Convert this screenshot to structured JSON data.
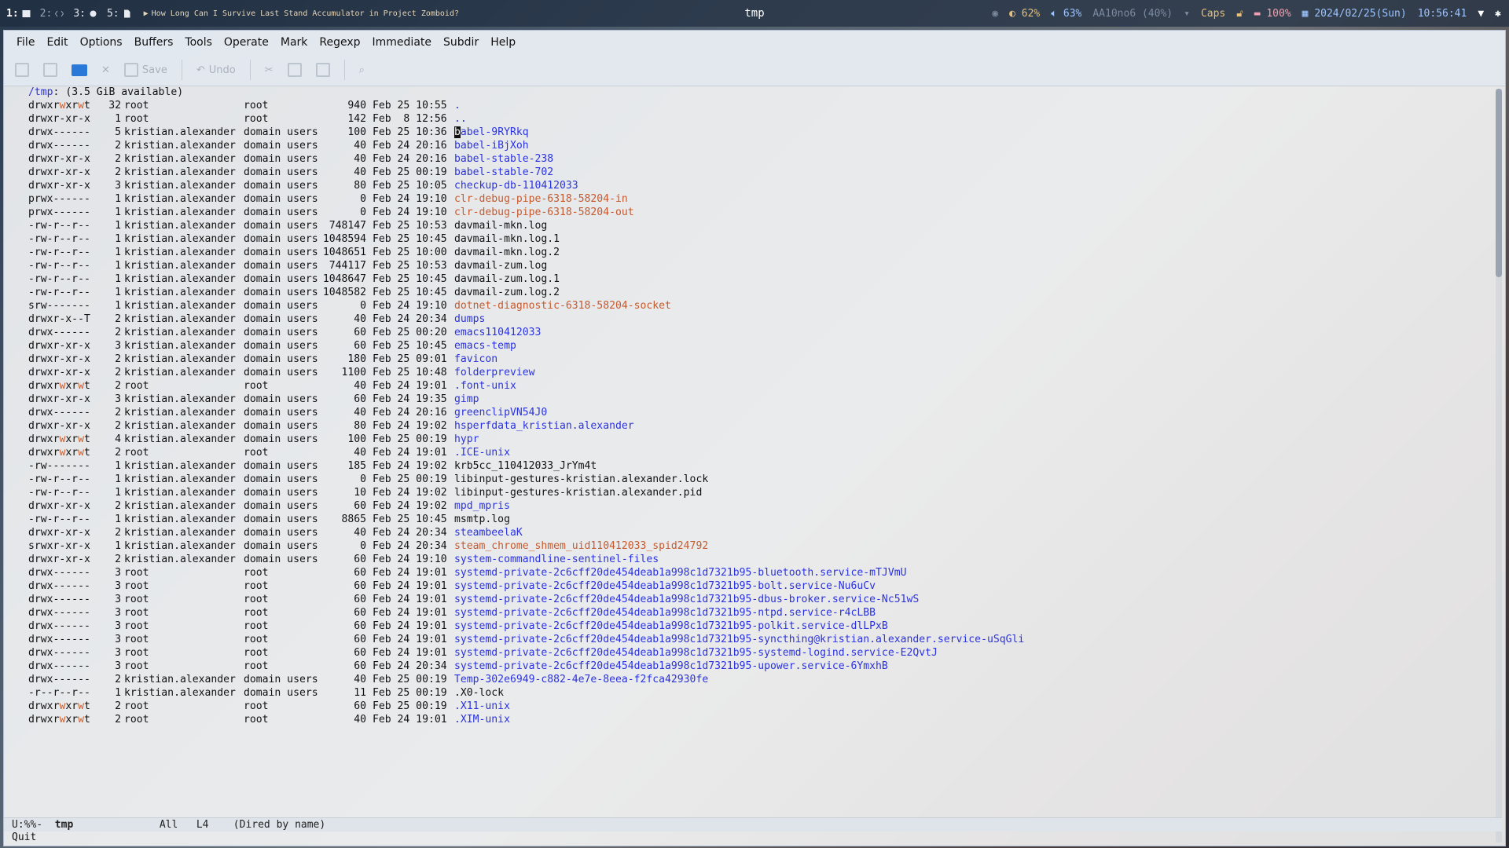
{
  "topbar": {
    "workspaces": [
      {
        "num": "1:",
        "icon": "terminal-icon"
      },
      {
        "num": "2:",
        "icon": "code-icon"
      },
      {
        "num": "3:",
        "icon": "circle-icon"
      },
      {
        "num": "5:",
        "icon": "file-icon"
      }
    ],
    "window_title": "How Long Can I Survive Last Stand Accumulator in Project Zomboid?",
    "center_title": "tmp",
    "brightness": "62%",
    "volume": "63%",
    "keyboard": "AA10no6 (40%)",
    "caps": "Caps",
    "battery": "100%",
    "date": "2024/02/25(Sun)",
    "time": "10:56:41"
  },
  "menu": [
    "File",
    "Edit",
    "Options",
    "Buffers",
    "Tools",
    "Operate",
    "Mark",
    "Regexp",
    "Immediate",
    "Subdir",
    "Help"
  ],
  "toolbar": {
    "save_label": "Save",
    "undo_label": "Undo"
  },
  "dired": {
    "header_path": "/tmp",
    "header_rest": ": (3.5 GiB available)",
    "entries": [
      {
        "perm": "drwxrwxrwt",
        "links": "32",
        "owner": "root",
        "group": "root",
        "size": "940",
        "date": "Feb 25 10:55",
        "name": ".",
        "kind": "dir"
      },
      {
        "perm": "drwxr-xr-x",
        "links": "1",
        "owner": "root",
        "group": "root",
        "size": "142",
        "date": "Feb  8 12:56",
        "name": "..",
        "kind": "dir"
      },
      {
        "perm": "drwx------",
        "links": "5",
        "owner": "kristian.alexander",
        "group": "domain users",
        "size": "100",
        "date": "Feb 25 10:36",
        "name": "babel-9RYRkq",
        "kind": "dir"
      },
      {
        "perm": "drwx------",
        "links": "2",
        "owner": "kristian.alexander",
        "group": "domain users",
        "size": "40",
        "date": "Feb 24 20:16",
        "name": "babel-iBjXoh",
        "kind": "dir"
      },
      {
        "perm": "drwxr-xr-x",
        "links": "2",
        "owner": "kristian.alexander",
        "group": "domain users",
        "size": "40",
        "date": "Feb 24 20:16",
        "name": "babel-stable-238",
        "kind": "dir"
      },
      {
        "perm": "drwxr-xr-x",
        "links": "2",
        "owner": "kristian.alexander",
        "group": "domain users",
        "size": "40",
        "date": "Feb 25 00:19",
        "name": "babel-stable-702",
        "kind": "dir"
      },
      {
        "perm": "drwxr-xr-x",
        "links": "3",
        "owner": "kristian.alexander",
        "group": "domain users",
        "size": "80",
        "date": "Feb 25 10:05",
        "name": "checkup-db-110412033",
        "kind": "dir"
      },
      {
        "perm": "prwx------",
        "links": "1",
        "owner": "kristian.alexander",
        "group": "domain users",
        "size": "0",
        "date": "Feb 24 19:10",
        "name": "clr-debug-pipe-6318-58204-in",
        "kind": "special"
      },
      {
        "perm": "prwx------",
        "links": "1",
        "owner": "kristian.alexander",
        "group": "domain users",
        "size": "0",
        "date": "Feb 24 19:10",
        "name": "clr-debug-pipe-6318-58204-out",
        "kind": "special"
      },
      {
        "perm": "-rw-r--r--",
        "links": "1",
        "owner": "kristian.alexander",
        "group": "domain users",
        "size": "748147",
        "date": "Feb 25 10:53",
        "name": "davmail-mkn.log",
        "kind": "file"
      },
      {
        "perm": "-rw-r--r--",
        "links": "1",
        "owner": "kristian.alexander",
        "group": "domain users",
        "size": "1048594",
        "date": "Feb 25 10:45",
        "name": "davmail-mkn.log.1",
        "kind": "file"
      },
      {
        "perm": "-rw-r--r--",
        "links": "1",
        "owner": "kristian.alexander",
        "group": "domain users",
        "size": "1048651",
        "date": "Feb 25 10:00",
        "name": "davmail-mkn.log.2",
        "kind": "file"
      },
      {
        "perm": "-rw-r--r--",
        "links": "1",
        "owner": "kristian.alexander",
        "group": "domain users",
        "size": "744117",
        "date": "Feb 25 10:53",
        "name": "davmail-zum.log",
        "kind": "file"
      },
      {
        "perm": "-rw-r--r--",
        "links": "1",
        "owner": "kristian.alexander",
        "group": "domain users",
        "size": "1048647",
        "date": "Feb 25 10:45",
        "name": "davmail-zum.log.1",
        "kind": "file"
      },
      {
        "perm": "-rw-r--r--",
        "links": "1",
        "owner": "kristian.alexander",
        "group": "domain users",
        "size": "1048582",
        "date": "Feb 25 10:45",
        "name": "davmail-zum.log.2",
        "kind": "file"
      },
      {
        "perm": "srw-------",
        "links": "1",
        "owner": "kristian.alexander",
        "group": "domain users",
        "size": "0",
        "date": "Feb 24 19:10",
        "name": "dotnet-diagnostic-6318-58204-socket",
        "kind": "special"
      },
      {
        "perm": "drwxr-x--T",
        "links": "2",
        "owner": "kristian.alexander",
        "group": "domain users",
        "size": "40",
        "date": "Feb 24 20:34",
        "name": "dumps",
        "kind": "dir"
      },
      {
        "perm": "drwx------",
        "links": "2",
        "owner": "kristian.alexander",
        "group": "domain users",
        "size": "60",
        "date": "Feb 25 00:20",
        "name": "emacs110412033",
        "kind": "dir"
      },
      {
        "perm": "drwxr-xr-x",
        "links": "3",
        "owner": "kristian.alexander",
        "group": "domain users",
        "size": "60",
        "date": "Feb 25 10:45",
        "name": "emacs-temp",
        "kind": "dir"
      },
      {
        "perm": "drwxr-xr-x",
        "links": "2",
        "owner": "kristian.alexander",
        "group": "domain users",
        "size": "180",
        "date": "Feb 25 09:01",
        "name": "favicon",
        "kind": "dir"
      },
      {
        "perm": "drwxr-xr-x",
        "links": "2",
        "owner": "kristian.alexander",
        "group": "domain users",
        "size": "1100",
        "date": "Feb 25 10:48",
        "name": "folderpreview",
        "kind": "dir"
      },
      {
        "perm": "drwxrwxrwt",
        "links": "2",
        "owner": "root",
        "group": "root",
        "size": "40",
        "date": "Feb 24 19:01",
        "name": ".font-unix",
        "kind": "dir"
      },
      {
        "perm": "drwxr-xr-x",
        "links": "3",
        "owner": "kristian.alexander",
        "group": "domain users",
        "size": "60",
        "date": "Feb 24 19:35",
        "name": "gimp",
        "kind": "dir"
      },
      {
        "perm": "drwx------",
        "links": "2",
        "owner": "kristian.alexander",
        "group": "domain users",
        "size": "40",
        "date": "Feb 24 20:16",
        "name": "greenclipVN54J0",
        "kind": "dir"
      },
      {
        "perm": "drwxr-xr-x",
        "links": "2",
        "owner": "kristian.alexander",
        "group": "domain users",
        "size": "80",
        "date": "Feb 24 19:02",
        "name": "hsperfdata_kristian.alexander",
        "kind": "dir"
      },
      {
        "perm": "drwxrwxrwt",
        "links": "4",
        "owner": "kristian.alexander",
        "group": "domain users",
        "size": "100",
        "date": "Feb 25 00:19",
        "name": "hypr",
        "kind": "dir"
      },
      {
        "perm": "drwxrwxrwt",
        "links": "2",
        "owner": "root",
        "group": "root",
        "size": "40",
        "date": "Feb 24 19:01",
        "name": ".ICE-unix",
        "kind": "dir"
      },
      {
        "perm": "-rw-------",
        "links": "1",
        "owner": "kristian.alexander",
        "group": "domain users",
        "size": "185",
        "date": "Feb 24 19:02",
        "name": "krb5cc_110412033_JrYm4t",
        "kind": "file"
      },
      {
        "perm": "-rw-r--r--",
        "links": "1",
        "owner": "kristian.alexander",
        "group": "domain users",
        "size": "0",
        "date": "Feb 25 00:19",
        "name": "libinput-gestures-kristian.alexander.lock",
        "kind": "file"
      },
      {
        "perm": "-rw-r--r--",
        "links": "1",
        "owner": "kristian.alexander",
        "group": "domain users",
        "size": "10",
        "date": "Feb 24 19:02",
        "name": "libinput-gestures-kristian.alexander.pid",
        "kind": "file"
      },
      {
        "perm": "drwxr-xr-x",
        "links": "2",
        "owner": "kristian.alexander",
        "group": "domain users",
        "size": "60",
        "date": "Feb 24 19:02",
        "name": "mpd_mpris",
        "kind": "dir"
      },
      {
        "perm": "-rw-r--r--",
        "links": "1",
        "owner": "kristian.alexander",
        "group": "domain users",
        "size": "8865",
        "date": "Feb 25 10:45",
        "name": "msmtp.log",
        "kind": "file"
      },
      {
        "perm": "drwxr-xr-x",
        "links": "2",
        "owner": "kristian.alexander",
        "group": "domain users",
        "size": "40",
        "date": "Feb 24 20:34",
        "name": "steambeelaK",
        "kind": "dir"
      },
      {
        "perm": "srwxr-xr-x",
        "links": "1",
        "owner": "kristian.alexander",
        "group": "domain users",
        "size": "0",
        "date": "Feb 24 20:34",
        "name": "steam_chrome_shmem_uid110412033_spid24792",
        "kind": "special"
      },
      {
        "perm": "drwxr-xr-x",
        "links": "2",
        "owner": "kristian.alexander",
        "group": "domain users",
        "size": "60",
        "date": "Feb 24 19:10",
        "name": "system-commandline-sentinel-files",
        "kind": "dir"
      },
      {
        "perm": "drwx------",
        "links": "3",
        "owner": "root",
        "group": "root",
        "size": "60",
        "date": "Feb 24 19:01",
        "name": "systemd-private-2c6cff20de454deab1a998c1d7321b95-bluetooth.service-mTJVmU",
        "kind": "dir"
      },
      {
        "perm": "drwx------",
        "links": "3",
        "owner": "root",
        "group": "root",
        "size": "60",
        "date": "Feb 24 19:01",
        "name": "systemd-private-2c6cff20de454deab1a998c1d7321b95-bolt.service-Nu6uCv",
        "kind": "dir"
      },
      {
        "perm": "drwx------",
        "links": "3",
        "owner": "root",
        "group": "root",
        "size": "60",
        "date": "Feb 24 19:01",
        "name": "systemd-private-2c6cff20de454deab1a998c1d7321b95-dbus-broker.service-Nc51wS",
        "kind": "dir"
      },
      {
        "perm": "drwx------",
        "links": "3",
        "owner": "root",
        "group": "root",
        "size": "60",
        "date": "Feb 24 19:01",
        "name": "systemd-private-2c6cff20de454deab1a998c1d7321b95-ntpd.service-r4cLBB",
        "kind": "dir"
      },
      {
        "perm": "drwx------",
        "links": "3",
        "owner": "root",
        "group": "root",
        "size": "60",
        "date": "Feb 24 19:01",
        "name": "systemd-private-2c6cff20de454deab1a998c1d7321b95-polkit.service-dlLPxB",
        "kind": "dir"
      },
      {
        "perm": "drwx------",
        "links": "3",
        "owner": "root",
        "group": "root",
        "size": "60",
        "date": "Feb 24 19:01",
        "name": "systemd-private-2c6cff20de454deab1a998c1d7321b95-syncthing@kristian.alexander.service-uSqGli",
        "kind": "dir"
      },
      {
        "perm": "drwx------",
        "links": "3",
        "owner": "root",
        "group": "root",
        "size": "60",
        "date": "Feb 24 19:01",
        "name": "systemd-private-2c6cff20de454deab1a998c1d7321b95-systemd-logind.service-E2QvtJ",
        "kind": "dir"
      },
      {
        "perm": "drwx------",
        "links": "3",
        "owner": "root",
        "group": "root",
        "size": "60",
        "date": "Feb 24 20:34",
        "name": "systemd-private-2c6cff20de454deab1a998c1d7321b95-upower.service-6YmxhB",
        "kind": "dir"
      },
      {
        "perm": "drwx------",
        "links": "2",
        "owner": "kristian.alexander",
        "group": "domain users",
        "size": "40",
        "date": "Feb 25 00:19",
        "name": "Temp-302e6949-c882-4e7e-8eea-f2fca42930fe",
        "kind": "dir"
      },
      {
        "perm": "-r--r--r--",
        "links": "1",
        "owner": "kristian.alexander",
        "group": "domain users",
        "size": "11",
        "date": "Feb 25 00:19",
        "name": ".X0-lock",
        "kind": "file"
      },
      {
        "perm": "drwxrwxrwt",
        "links": "2",
        "owner": "root",
        "group": "root",
        "size": "60",
        "date": "Feb 25 00:19",
        "name": ".X11-unix",
        "kind": "dir"
      },
      {
        "perm": "drwxrwxrwt",
        "links": "2",
        "owner": "root",
        "group": "root",
        "size": "40",
        "date": "Feb 24 19:01",
        "name": ".XIM-unix",
        "kind": "dir"
      }
    ]
  },
  "modeline": {
    "status": "U:%%-",
    "buffer": "tmp",
    "position": "All",
    "line": "L4",
    "mode": "(Dired by name)"
  },
  "echo": "Quit",
  "colors": {
    "dir": "#2a32e0",
    "special": "#c65a2e",
    "file": "#111111"
  }
}
